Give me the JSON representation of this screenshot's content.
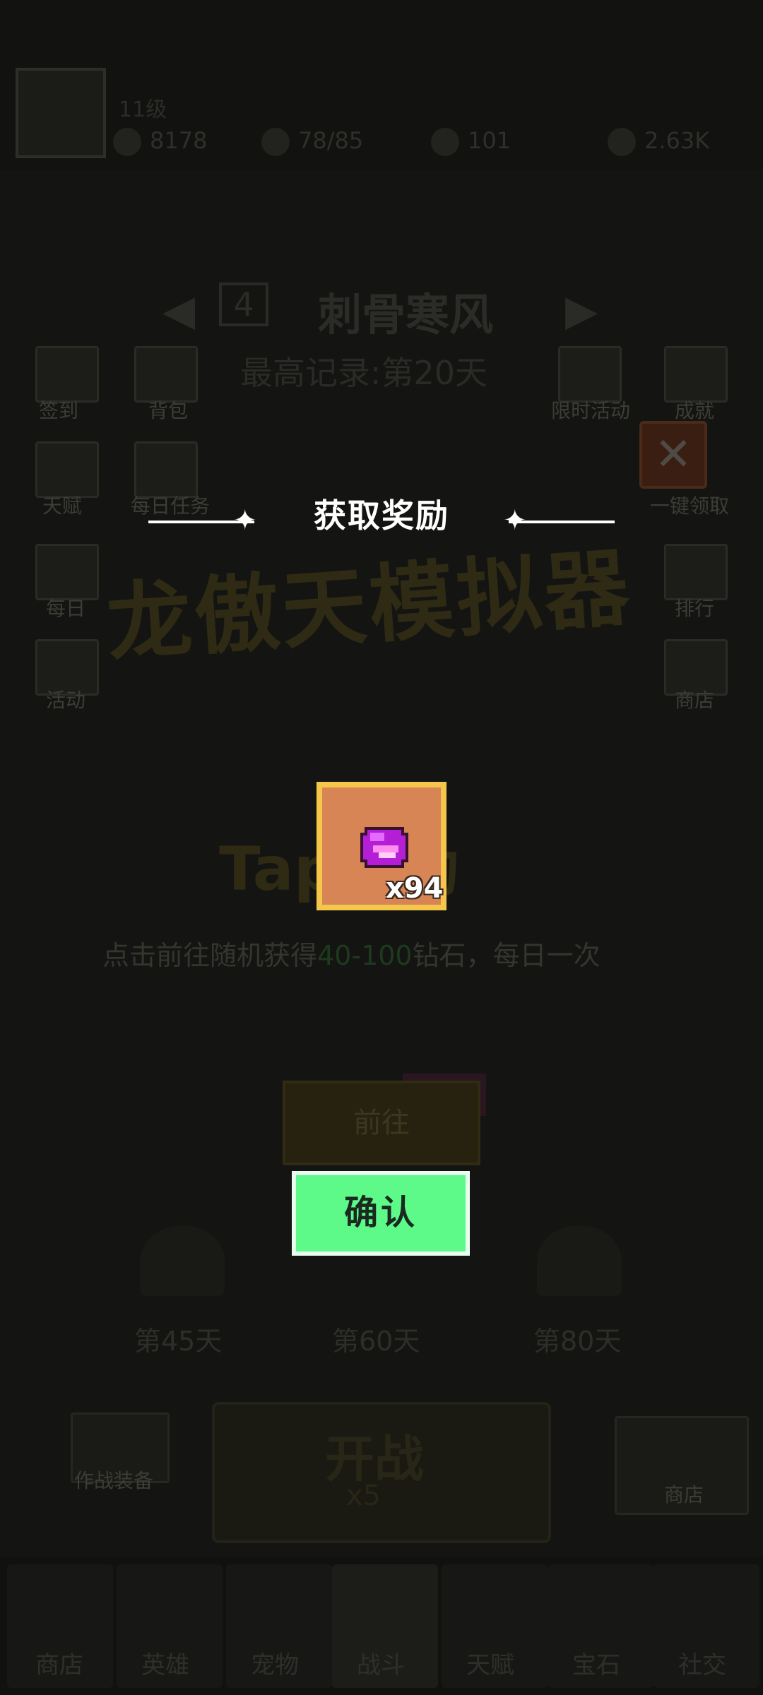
{
  "top": {
    "level_label": "11级",
    "exp_text": "8178",
    "energy": "78/85",
    "gems": "101",
    "gold": "2.63K"
  },
  "stage": {
    "number": "4",
    "title": "刺骨寒风",
    "record": "最高记录:第20天"
  },
  "side_left": [
    "签到",
    "背包",
    "天赋",
    "每日任务",
    "每日",
    "活动"
  ],
  "side_right": [
    "限时活动",
    "成就",
    "一键领取",
    "排行",
    "商店"
  ],
  "logo": "龙傲天模拟器",
  "tap": {
    "title": "Tap活动",
    "desc_prefix": "点击前往随机获得",
    "desc_highlight": "40-100",
    "desc_suffix": "钻石，每日一次",
    "go_label": "前往"
  },
  "days": [
    "第45天",
    "第60天",
    "第80天"
  ],
  "battle": {
    "label": "开战",
    "cost": "x5",
    "left_label": "作战装备",
    "right_label": "商店"
  },
  "nav": [
    "商店",
    "英雄",
    "宠物",
    "战斗",
    "天赋",
    "宝石",
    "社交"
  ],
  "dialog": {
    "title": "获取奖励",
    "item_count": "x94",
    "confirm_label": "确认",
    "close_symbol": "✕"
  },
  "colors": {
    "confirm": "#5dfa8a",
    "card_bg": "#d88556",
    "card_border": "#f4c64a",
    "gem": "#b41fd6"
  }
}
